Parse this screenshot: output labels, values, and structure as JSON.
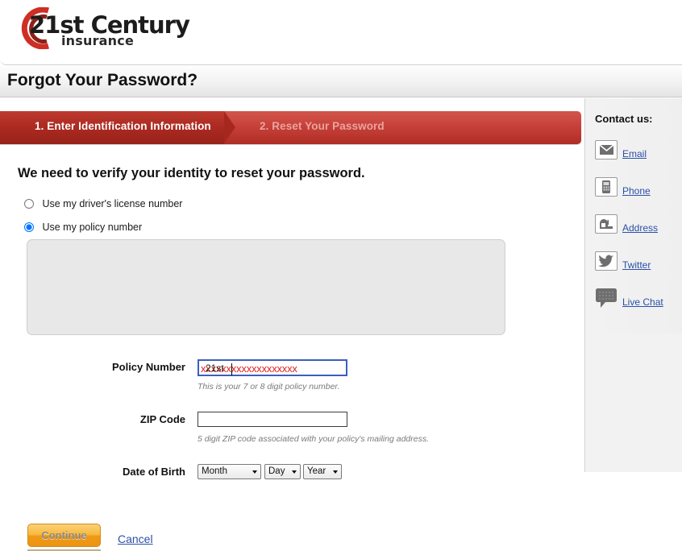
{
  "brand": {
    "logo_name": "21st Century Insurance",
    "logo_primary": "21st",
    "logo_secondary": " Century",
    "logo_tagline": "insurance",
    "arc_outer_color": "#cf2e24",
    "arc_inner_color": "#8e1f18"
  },
  "header": {
    "page_title": "Forgot Your Password?"
  },
  "steps": {
    "step1_label": "1. Enter Identification Information",
    "step2_label": "2. Reset Your Password",
    "active_color": "#ac2a21",
    "inactive_color": "#c7413a"
  },
  "form": {
    "lead": "We need to verify your identity to reset your password.",
    "options": [
      {
        "label": "Use my driver's license number",
        "selected": false
      },
      {
        "label": "Use my policy number",
        "selected": true
      }
    ],
    "policy": {
      "label": "Policy Number",
      "value": "xxxxxxxxxxxxxxxxxxx",
      "overlay_text": "21st",
      "hint": "This is your 7 or 8 digit policy number.",
      "value_color": "#e02020"
    },
    "zip": {
      "label": "ZIP Code",
      "value": "",
      "hint": "5 digit ZIP code associated with your policy's mailing address."
    },
    "dob": {
      "label": "Date of Birth",
      "month": "Month",
      "day": "Day",
      "year": "Year"
    }
  },
  "actions": {
    "continue_label": "Continue",
    "cancel_label": "Cancel"
  },
  "sidebar": {
    "title": "Contact us:",
    "items": [
      {
        "label": "Email",
        "icon": "envelope-icon"
      },
      {
        "label": "Phone",
        "icon": "mobile-phone-icon"
      },
      {
        "label": "Address",
        "icon": "mailbox-icon"
      },
      {
        "label": "Twitter",
        "icon": "twitter-bird-icon"
      },
      {
        "label": "Live Chat",
        "icon": "speech-bubble-icon"
      }
    ]
  }
}
